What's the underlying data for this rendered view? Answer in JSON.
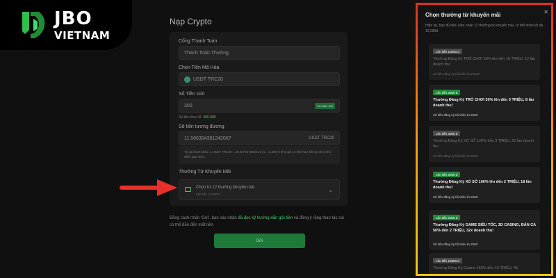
{
  "logo": {
    "brand": "JBO",
    "sub": "VIETNAM"
  },
  "form": {
    "title": "Nạp Crypto",
    "gateway": {
      "label": "Cổng Thanh Toán",
      "value": "Thanh Toán Thường"
    },
    "coin": {
      "label": "Chọn Tiền Mã Hóa",
      "value": "USDT TRC20"
    },
    "amount": {
      "label": "Số Tiền Gửi",
      "value": "300",
      "min_badge": "Tối thiểu 100",
      "actual_prefix": "Số tiền thực tế:",
      "actual_value": "300.000"
    },
    "equivalent": {
      "label": "Số tiền tương đương",
      "value": "11.566384381242067",
      "unit": "USDT TRC20"
    },
    "rate_note": "Tỷ giá tham khảo: 1 USDT TRC20 = 25.93743738101 đ (1 = 1,390) tỉ lệ tỷ giá có thể thay đổi tùy theo thời điểm giao dịch.",
    "promo": {
      "label": "Thưởng Từ Khuyến Mãi",
      "main": "Chọn từ 12 thưởng khuyến mãi.",
      "sub": "Lần tiền 12.000 đ"
    },
    "agree_prefix": "Bằng cách nhấn 'Gửi', bạn xác nhận",
    "agree_link": "đã đọc kỹ hướng dẫn gửi tiền",
    "agree_suffix": "và đồng ý rằng thao tác sai có thể dẫn đến mất tiền.",
    "submit_label": "Gửi"
  },
  "modal": {
    "title": "Chọn thưởng từ khuyến mãi",
    "close": "✕",
    "desc": "Hiện tại, bạn đủ điều kiện nhận 12 thưởng từ khuyến mãi, có thể nhận tối đa 12,000đ",
    "cards": [
      {
        "tag": "Lên đến 10000 đ",
        "title": "Thưởng Đăng Ký TRÒ CHƠI 50% lên đến 10 TRIỆU, 12 lần doanh thu",
        "min": "Số tiền đăng ký tối thiểu là 1000đ",
        "active": false
      },
      {
        "tag": "Lên đến 3000 đ",
        "title": "Thưởng Đăng Ký TRÒ CHƠI 30% lên đến 3 TRIỆU, 8 lần doanh thu!",
        "min": "Số tiền đăng ký tối thiểu là 200đ",
        "active": true
      },
      {
        "tag": "Lên đến 3000 đ",
        "title": "Thưởng Đăng Ký XỔ SỐ 120% đến 3 TRIỆU, 22 lần doanh thu",
        "min": "Số tiền đăng ký tối thiểu là 200đ",
        "active": false
      },
      {
        "tag": "Lên đến 2000 đ",
        "title": "Thưởng Đăng Ký XỔ SỐ 100% lên đến 2 TRIỆU, 18 lần doanh thu!",
        "min": "Số tiền đăng ký tối thiểu là 200đ",
        "active": true
      },
      {
        "tag": "Lên đến 2000 đ",
        "title": "Thưởng Đăng Ký GAME SIÊU TỐC, 3D CASINO, BẮN CÁ 50% đến 2 TRIỆU, 32x doanh thu!",
        "min": "Số tiền đăng ký tối thiểu là 200đ",
        "active": true
      },
      {
        "tag": "Lên đến 10000 đ",
        "title": "Thưởng Đăng Ký Casino 150% đến 10 TRIỆU, 45",
        "min": "",
        "active": false
      }
    ]
  },
  "colors": {
    "accent_green": "#1f7a3a",
    "border_top": "#e0301e",
    "border_bottom": "#f5c518",
    "arrow": "#e8302a"
  }
}
